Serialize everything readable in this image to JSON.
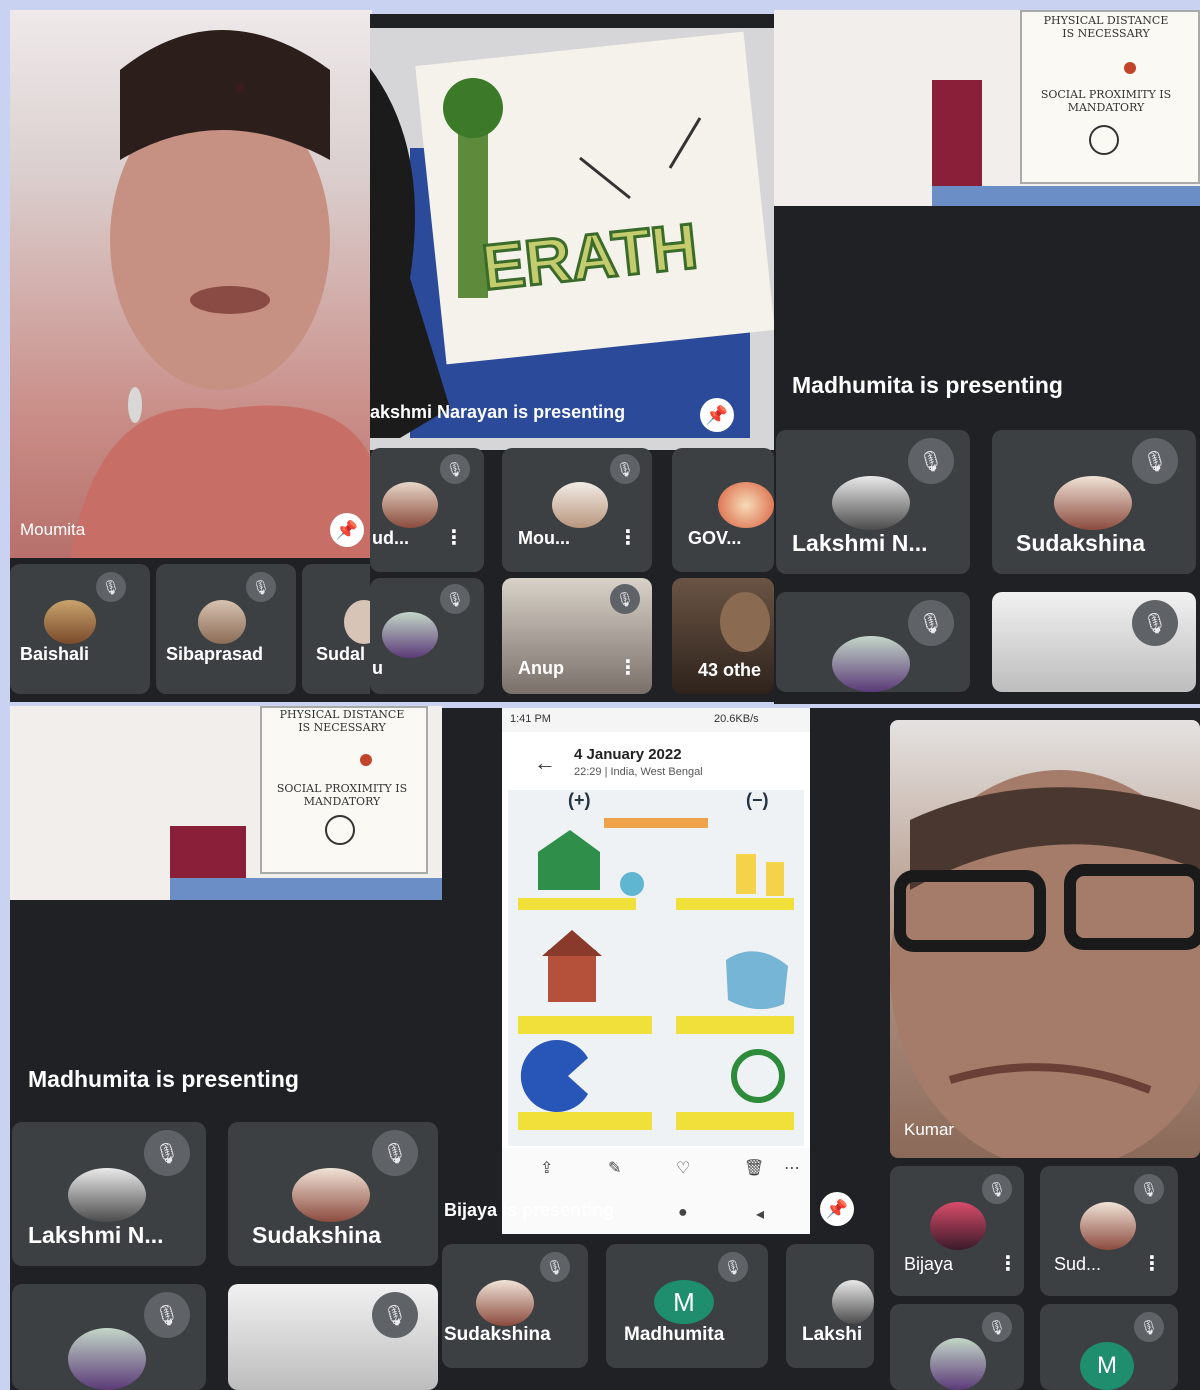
{
  "panel1": {
    "main_name": "Moumita",
    "tiles": [
      "Baishali",
      "Sibaprasad",
      "Sudal"
    ]
  },
  "panel2": {
    "banner": "akshmi Narayan is presenting",
    "poster_word": "ERATH",
    "tiles_row1": [
      "ud...",
      "Mou...",
      "GOV..."
    ],
    "tiles_row2": [
      "u",
      "Anup",
      "43 othe"
    ]
  },
  "panel3": {
    "poster_title": "PHYSICAL DISTANCE IS NECESSARY",
    "poster_subtitle": "SOCIAL PROXIMITY IS MANDATORY",
    "banner": "Madhumita is presenting",
    "tiles": [
      "Lakshmi N...",
      "Sudakshina"
    ]
  },
  "panel4": {
    "poster_title": "PHYSICAL DISTANCE IS NECESSARY",
    "poster_subtitle": "SOCIAL PROXIMITY IS MANDATORY",
    "banner": "Madhumita is presenting",
    "tiles": [
      "Lakshmi N...",
      "Sudakshina"
    ]
  },
  "panel5": {
    "status_time": "1:41 PM",
    "status_speed": "20.6KB/s",
    "photo_date": "4 January 2022",
    "photo_meta": "22:29 | India, West Bengal",
    "poster_plus": "(+)",
    "poster_minus": "(−)",
    "banner": "Bijaya is presenting",
    "tiles": [
      "Sudakshina",
      "Madhumita",
      "Lakshi"
    ],
    "avatar_letter": "M"
  },
  "panel6": {
    "main_name": "Kumar",
    "tiles": [
      "Bijaya",
      "Sud..."
    ],
    "avatar_letter": "M"
  },
  "icons": {
    "mic_off": "🎙",
    "pin": "📌",
    "more": "⋮",
    "back": "←"
  }
}
